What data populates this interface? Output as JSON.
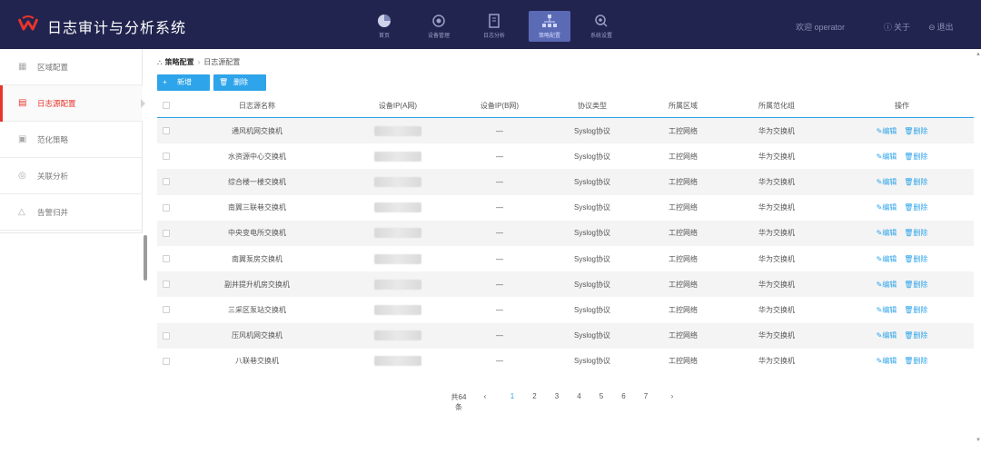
{
  "header": {
    "title": "日志审计与分析系统",
    "logo_color": "#e8342c",
    "nav": [
      {
        "label": "首页",
        "icon": "pie-chart-icon"
      },
      {
        "label": "设备管理",
        "icon": "device-icon"
      },
      {
        "label": "日志分析",
        "icon": "document-icon"
      },
      {
        "label": "策略配置",
        "icon": "strategy-icon",
        "active": true
      },
      {
        "label": "系统设置",
        "icon": "settings-icon"
      }
    ],
    "welcome": "欢迎 operator",
    "about_label": "关于",
    "logout_label": "退出"
  },
  "sidebar": {
    "items": [
      {
        "label": "区域配置",
        "icon": "grid-icon"
      },
      {
        "label": "日志源配置",
        "icon": "log-source-icon",
        "active": true
      },
      {
        "label": "范化策略",
        "icon": "policy-icon"
      },
      {
        "label": "关联分析",
        "icon": "correlation-icon"
      },
      {
        "label": "告警归并",
        "icon": "alert-icon"
      }
    ]
  },
  "breadcrumb": {
    "root": "策略配置",
    "current": "日志源配置"
  },
  "toolbar": {
    "add_label": "新增",
    "delete_label": "删除",
    "button_color": "#2ea4ea"
  },
  "table": {
    "headers": [
      "日志源名称",
      "设备IP(A网)",
      "设备IP(B网)",
      "协议类型",
      "所属区域",
      "所属范化组",
      "操作"
    ],
    "edit_label": "编辑",
    "delete_label": "删除",
    "rows": [
      {
        "name": "通风机网交换机",
        "ip_b": "—",
        "protocol": "Syslog协议",
        "area": "工控网络",
        "group": "华为交换机"
      },
      {
        "name": "水资源中心交换机",
        "ip_b": "—",
        "protocol": "Syslog协议",
        "area": "工控网络",
        "group": "华为交换机"
      },
      {
        "name": "综合楼一楼交换机",
        "ip_b": "—",
        "protocol": "Syslog协议",
        "area": "工控网络",
        "group": "华为交换机"
      },
      {
        "name": "南翼三联巷交换机",
        "ip_b": "—",
        "protocol": "Syslog协议",
        "area": "工控网络",
        "group": "华为交换机"
      },
      {
        "name": "中央变电所交换机",
        "ip_b": "—",
        "protocol": "Syslog协议",
        "area": "工控网络",
        "group": "华为交换机"
      },
      {
        "name": "南翼泵房交换机",
        "ip_b": "—",
        "protocol": "Syslog协议",
        "area": "工控网络",
        "group": "华为交换机"
      },
      {
        "name": "副井提升机房交换机",
        "ip_b": "—",
        "protocol": "Syslog协议",
        "area": "工控网络",
        "group": "华为交换机"
      },
      {
        "name": "三采区泵站交换机",
        "ip_b": "—",
        "protocol": "Syslog协议",
        "area": "工控网络",
        "group": "华为交换机"
      },
      {
        "name": "压风机网交换机",
        "ip_b": "—",
        "protocol": "Syslog协议",
        "area": "工控网络",
        "group": "华为交换机"
      },
      {
        "name": "八联巷交换机",
        "ip_b": "—",
        "protocol": "Syslog协议",
        "area": "工控网络",
        "group": "华为交换机"
      }
    ]
  },
  "pagination": {
    "total": "共64条",
    "prev": "‹",
    "next": "›",
    "pages": [
      "1",
      "2",
      "3",
      "4",
      "5",
      "6",
      "7"
    ],
    "current": "1"
  }
}
